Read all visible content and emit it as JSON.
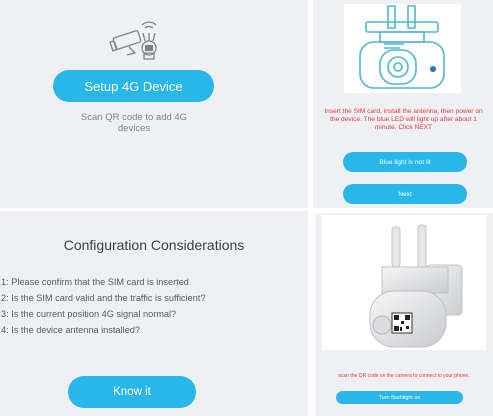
{
  "colors": {
    "accent": "#29b6e8",
    "panel_bg": "#eef0f3",
    "warning": "#e23a3a"
  },
  "setup_panel": {
    "icon": "camera-4g-icon",
    "button_label": "Setup 4G Device",
    "hint": "Scan QR code to add 4G devices"
  },
  "sim_panel": {
    "illustration": "camera-sim-illustration",
    "instruction": "Insert the SIM card, install the antenna, then power on the device. The blue LED will light up after about 1 minute. Click NEXT",
    "blue_light_button": "Blue light is not lit",
    "next_button": "Next"
  },
  "considerations_panel": {
    "title": "Configuration Considerations",
    "items": [
      "1: Please confirm that the SIM card is inserted",
      "2: Is the SIM card valid and the traffic is sufficient?",
      "3: Is the current position 4G signal normal?",
      "4: Is the device antenna installed?"
    ],
    "button_label": "Know it"
  },
  "qr_panel": {
    "photo": "camera-qr-photo",
    "instruction": "scan the QR code on the camera to connect to your phone.",
    "flashlight_button": "Turn flashlight on"
  }
}
